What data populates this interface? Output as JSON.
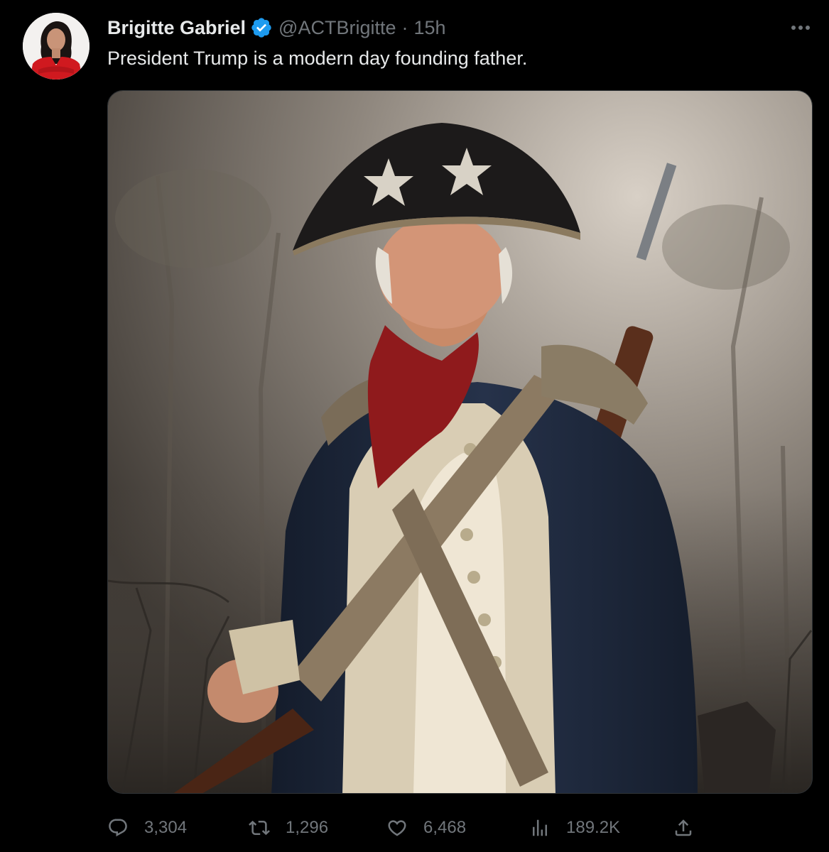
{
  "tweet": {
    "author": {
      "display_name": "Brigitte Gabriel",
      "handle": "@ACTBrigitte",
      "verified": true
    },
    "separator": "·",
    "timestamp": "15h",
    "text": "President Trump is a modern day founding father.",
    "media_description": "",
    "metrics": {
      "replies": "3,304",
      "retweets": "1,296",
      "likes": "6,468",
      "views": "189.2K"
    }
  },
  "colors": {
    "background": "#000000",
    "primary_text": "#e7e9ea",
    "secondary_text": "#71767b",
    "verified_badge": "#1d9bf0"
  },
  "icons": {
    "more": "more-horizontal-icon",
    "reply": "reply-icon",
    "retweet": "retweet-icon",
    "like": "heart-icon",
    "views": "views-bar-chart-icon",
    "share": "share-icon",
    "verified": "verified-badge-icon"
  }
}
